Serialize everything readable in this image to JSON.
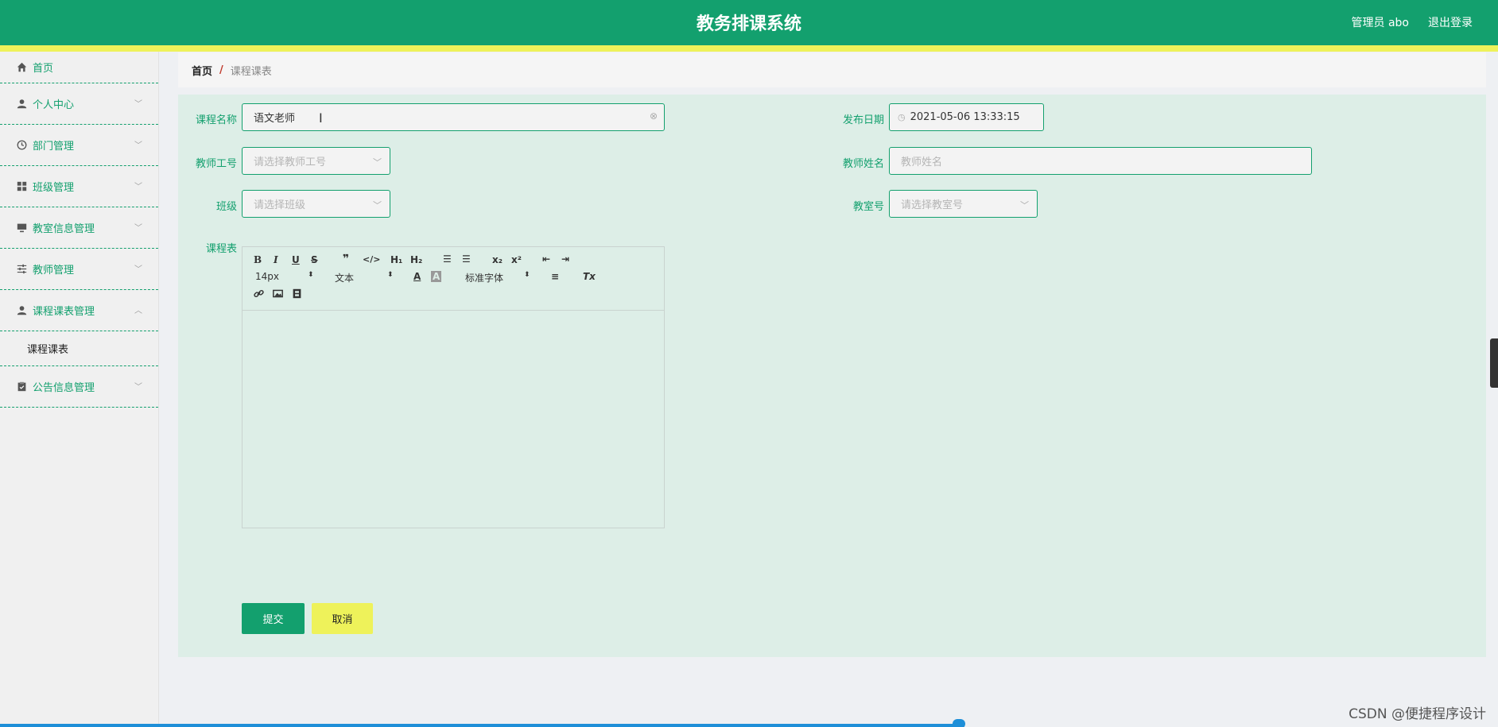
{
  "header": {
    "title": "教务排课系统",
    "user": "管理员 abo",
    "logout": "退出登录"
  },
  "sidebar": {
    "items": [
      {
        "label": "首页",
        "icon": "home-icon"
      },
      {
        "label": "个人中心",
        "icon": "person-icon"
      },
      {
        "label": "部门管理",
        "icon": "clock-icon"
      },
      {
        "label": "班级管理",
        "icon": "grid-icon"
      },
      {
        "label": "教室信息管理",
        "icon": "monitor-icon"
      },
      {
        "label": "教师管理",
        "icon": "sliders-icon"
      },
      {
        "label": "课程课表管理",
        "icon": "person-icon"
      },
      {
        "label": "公告信息管理",
        "icon": "clipboard-icon"
      }
    ],
    "subitem": "课程课表"
  },
  "breadcrumb": {
    "home": "首页",
    "sep": "/",
    "current": "课程课表"
  },
  "form": {
    "course_name_label": "课程名称",
    "course_name_value": "语文老师",
    "publish_date_label": "发布日期",
    "publish_date_value": "2021-05-06 13:33:15",
    "teacher_id_label": "教师工号",
    "teacher_id_placeholder": "请选择教师工号",
    "teacher_name_label": "教师姓名",
    "teacher_name_placeholder": "教师姓名",
    "class_label": "班级",
    "class_placeholder": "请选择班级",
    "classroom_label": "教室号",
    "classroom_placeholder": "请选择教室号",
    "schedule_label": "课程表",
    "submit": "提交",
    "cancel": "取消"
  },
  "editor": {
    "font_size": "14px",
    "header_select": "文本",
    "font_family": "标准字体"
  },
  "watermark": "CSDN @便捷程序设计"
}
